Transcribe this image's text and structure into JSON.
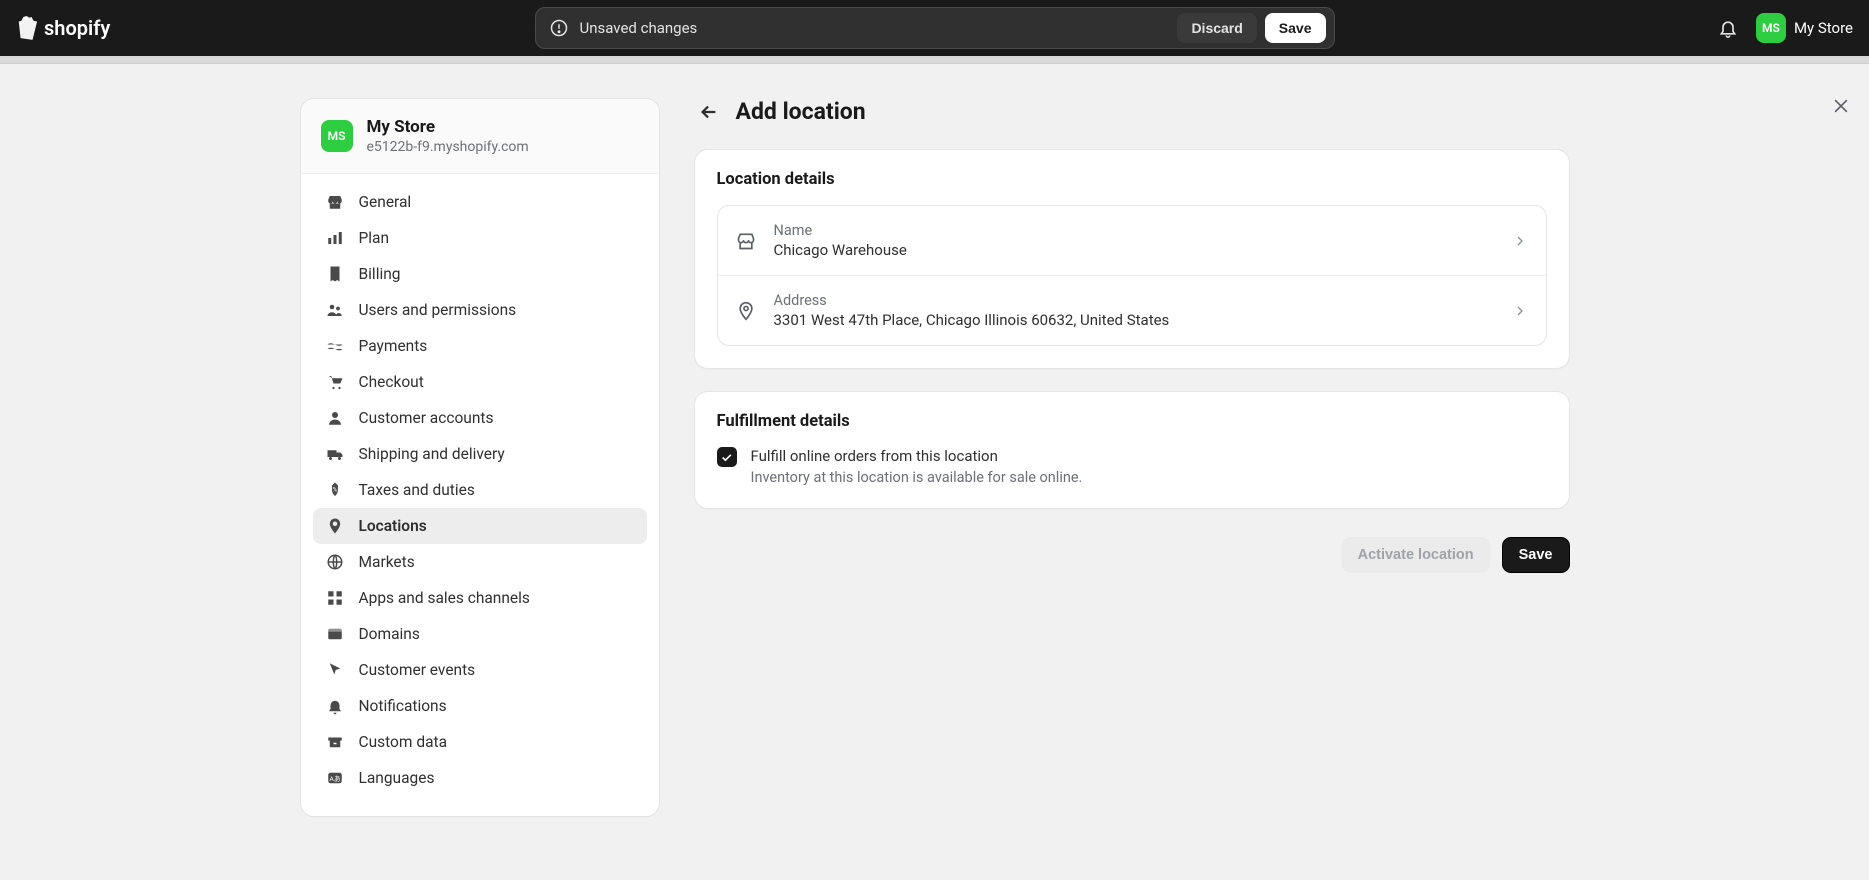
{
  "topbar": {
    "brand": "shopify",
    "unsaved_message": "Unsaved changes",
    "discard_label": "Discard",
    "save_label": "Save",
    "account_initials": "MS",
    "account_name": "My Store"
  },
  "sidebar": {
    "store_initials": "MS",
    "store_name": "My Store",
    "store_domain": "e5122b-f9.myshopify.com",
    "items": [
      {
        "label": "General"
      },
      {
        "label": "Plan"
      },
      {
        "label": "Billing"
      },
      {
        "label": "Users and permissions"
      },
      {
        "label": "Payments"
      },
      {
        "label": "Checkout"
      },
      {
        "label": "Customer accounts"
      },
      {
        "label": "Shipping and delivery"
      },
      {
        "label": "Taxes and duties"
      },
      {
        "label": "Locations"
      },
      {
        "label": "Markets"
      },
      {
        "label": "Apps and sales channels"
      },
      {
        "label": "Domains"
      },
      {
        "label": "Customer events"
      },
      {
        "label": "Notifications"
      },
      {
        "label": "Custom data"
      },
      {
        "label": "Languages"
      }
    ]
  },
  "main": {
    "title": "Add location",
    "location_details": {
      "heading": "Location details",
      "name_label": "Name",
      "name_value": "Chicago Warehouse",
      "address_label": "Address",
      "address_value": "3301 West 47th Place, Chicago Illinois 60632, United States"
    },
    "fulfillment": {
      "heading": "Fulfillment details",
      "checkbox_label": "Fulfill online orders from this location",
      "checkbox_hint": "Inventory at this location is available for sale online."
    },
    "footer": {
      "activate_label": "Activate location",
      "save_label": "Save"
    }
  }
}
